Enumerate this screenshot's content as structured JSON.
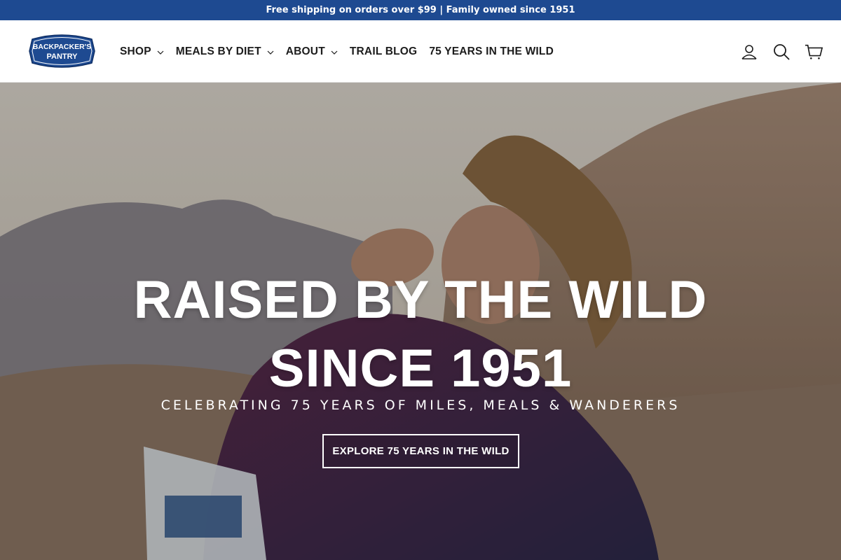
{
  "announcement": {
    "text": "Free shipping on orders over $99 | Family owned since 1951"
  },
  "brand": {
    "logo_line1": "BACKPACKER'S",
    "logo_line2": "PANTRY",
    "logo_color": "#1e4a91"
  },
  "nav": {
    "items": [
      {
        "label": "SHOP",
        "has_dropdown": true
      },
      {
        "label": "MEALS BY DIET",
        "has_dropdown": true
      },
      {
        "label": "ABOUT",
        "has_dropdown": true
      },
      {
        "label": "TRAIL BLOG",
        "has_dropdown": false
      },
      {
        "label": "75 YEARS IN THE WILD",
        "has_dropdown": false
      }
    ]
  },
  "header_icons": {
    "account": "user-icon",
    "search": "search-icon",
    "cart": "cart-icon"
  },
  "hero": {
    "title": "RAISED BY THE WILD SINCE 1951",
    "subtitle": "CELEBRATING 75 YEARS OF MILES, MEALS & WANDERERS",
    "cta_label": "EXPLORE 75 YEARS IN THE WILD"
  },
  "colors": {
    "announcement_bg": "#1e4a91",
    "text_dark": "#1c1c1c"
  }
}
